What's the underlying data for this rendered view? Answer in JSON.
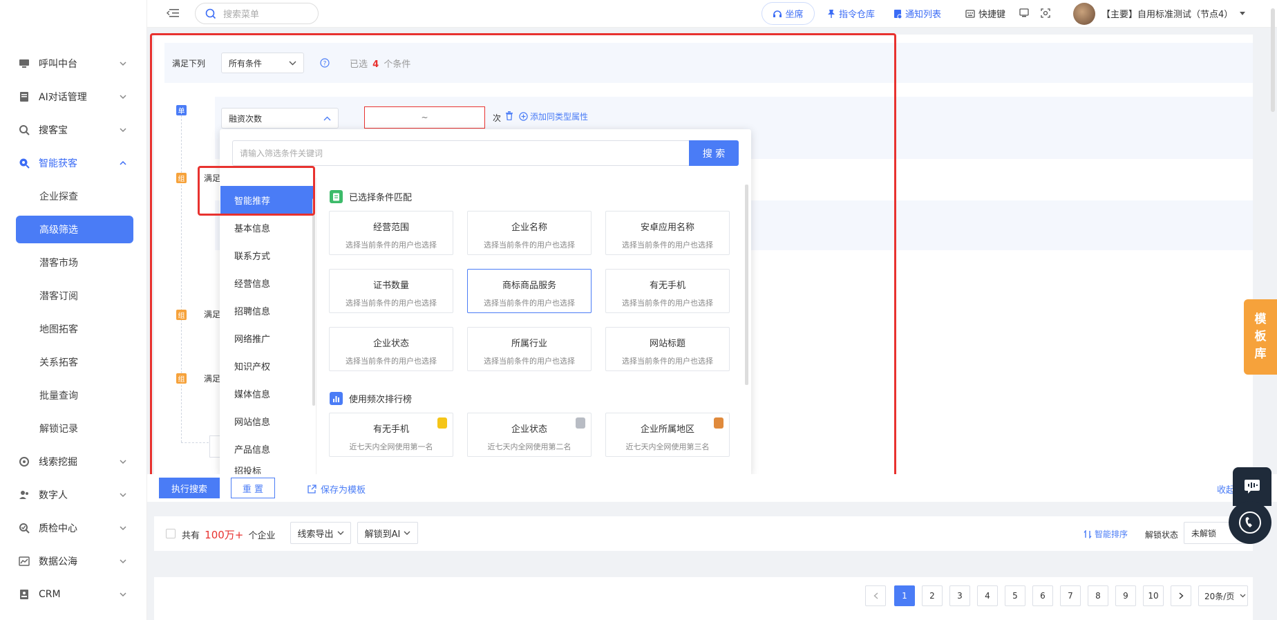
{
  "sidebar": {
    "items": [
      {
        "label": "呼叫中台",
        "icon": "monitor-icon"
      },
      {
        "label": "AI对话管理",
        "icon": "document-icon"
      },
      {
        "label": "搜客宝",
        "icon": "magnifier-icon"
      },
      {
        "label": "智能获客",
        "icon": "target-search-icon"
      },
      {
        "label": "线索挖掘",
        "icon": "radar-icon"
      },
      {
        "label": "数字人",
        "icon": "user-group-icon"
      },
      {
        "label": "质检中心",
        "icon": "check-search-icon"
      },
      {
        "label": "数据公海",
        "icon": "chart-icon"
      },
      {
        "label": "CRM",
        "icon": "contact-card-icon"
      }
    ],
    "subitems": [
      "企业探查",
      "高级筛选",
      "潜客市场",
      "潜客订阅",
      "地图拓客",
      "关系拓客",
      "批量查询",
      "解锁记录"
    ]
  },
  "topbar": {
    "search_placeholder": "搜索菜单",
    "seat": "坐席",
    "command": "指令仓库",
    "notify": "通知列表",
    "hotkey": "快捷键",
    "account": "【主要】自用标准测试（节点4）"
  },
  "filter": {
    "satisfy_prefix": "满足下列",
    "satisfy_value": "所有条件",
    "selected_prefix": "已选",
    "selected_count": "4",
    "selected_suffix": "个条件",
    "tag_single": "单",
    "tag_group": "组",
    "group_label": "满足",
    "field_value": "融资次数",
    "range_sep": "~",
    "unit": "次",
    "add_same": "添加同类型属性"
  },
  "dropdown": {
    "search_placeholder": "请输入筛选条件关键词",
    "search_button": "搜 索",
    "categories": [
      "智能推荐",
      "基本信息",
      "联系方式",
      "经营信息",
      "招聘信息",
      "网络推广",
      "知识产权",
      "媒体信息",
      "网站信息",
      "产品信息",
      "招投标"
    ],
    "section1_title": "已选择条件匹配",
    "section1_cards": [
      {
        "title": "经营范围",
        "sub": "选择当前条件的用户也选择"
      },
      {
        "title": "企业名称",
        "sub": "选择当前条件的用户也选择"
      },
      {
        "title": "安卓应用名称",
        "sub": "选择当前条件的用户也选择"
      },
      {
        "title": "证书数量",
        "sub": "选择当前条件的用户也选择"
      },
      {
        "title": "商标商品服务",
        "sub": "选择当前条件的用户也选择"
      },
      {
        "title": "有无手机",
        "sub": "选择当前条件的用户也选择"
      },
      {
        "title": "企业状态",
        "sub": "选择当前条件的用户也选择"
      },
      {
        "title": "所属行业",
        "sub": "选择当前条件的用户也选择"
      },
      {
        "title": "网站标题",
        "sub": "选择当前条件的用户也选择"
      }
    ],
    "section2_title": "使用频次排行榜",
    "section2_cards": [
      {
        "title": "有无手机",
        "sub": "近七天内全网使用第一名",
        "medal": "#f5c518"
      },
      {
        "title": "企业状态",
        "sub": "近七天内全网使用第二名",
        "medal": "#b8bcc4"
      },
      {
        "title": "企业所属地区",
        "sub": "近七天内全网使用第三名",
        "medal": "#e08a3c"
      }
    ]
  },
  "actions": {
    "search": "执行搜索",
    "reset": "重 置",
    "save_template": "保存为模板",
    "collapse": "收起"
  },
  "results": {
    "total_prefix": "共有",
    "total_count": "100万+",
    "total_suffix": "个企业",
    "export": "线索导出",
    "unlock_ai": "解锁到AI",
    "smart_sort": "智能排序",
    "unlock_status_label": "解锁状态",
    "unlock_status_value": "未解锁"
  },
  "pagination": {
    "pages": [
      "1",
      "2",
      "3",
      "4",
      "5",
      "6",
      "7",
      "8",
      "9",
      "10"
    ],
    "current": "1",
    "per_page": "20条/页"
  },
  "template_tab": [
    "模",
    "板",
    "库"
  ],
  "colors": {
    "accent": "#4a7cf6",
    "highlight": "#e8322f",
    "orange": "#f6a23b"
  }
}
